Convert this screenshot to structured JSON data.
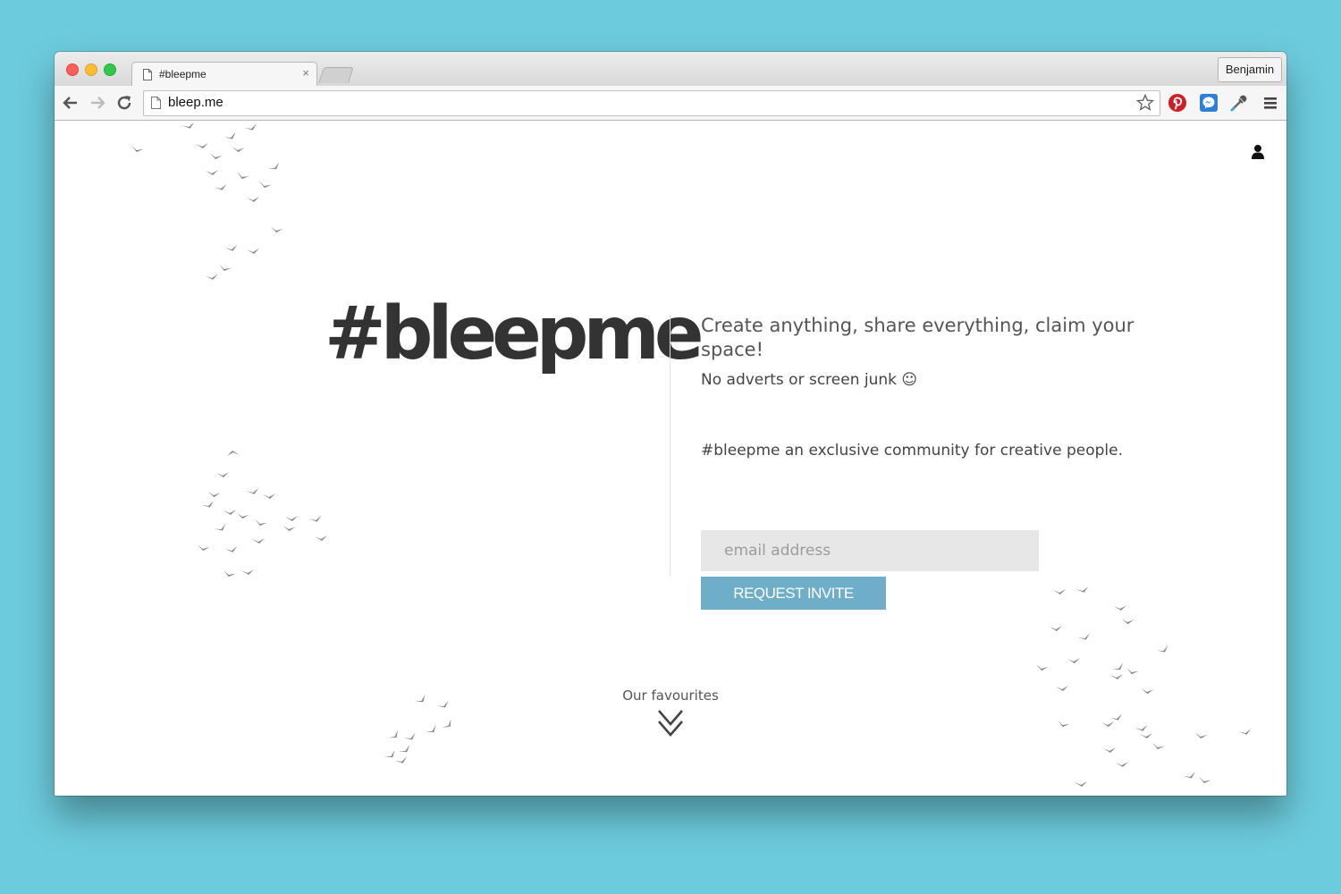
{
  "browser": {
    "tab": {
      "title": "#bleepme",
      "close_glyph": "×"
    },
    "profile_name": "Benjamin",
    "address_bar": {
      "url": "bleep.me"
    },
    "icons": [
      "back-icon",
      "forward-icon",
      "reload-icon",
      "page-icon",
      "bookmark-star-icon",
      "pinterest-icon",
      "messenger-icon",
      "eyedropper-icon",
      "menu-icon"
    ]
  },
  "page": {
    "logo_text": "#bleepme",
    "headline": "Create anything, share everything, claim your space!",
    "subline": "No adverts or screen junk ☺",
    "community_text": "#bleepme an exclusive community for creative people.",
    "email_input": {
      "placeholder": "email address",
      "value": ""
    },
    "request_button_label": "REQUEST INVITE",
    "favourites_label": "Our favourites",
    "accent_color": "#6eaec8"
  }
}
